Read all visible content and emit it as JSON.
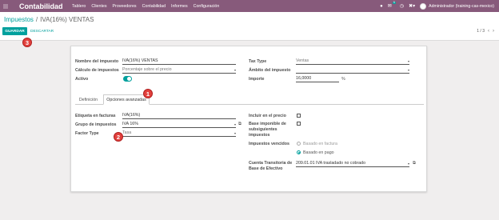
{
  "navbar": {
    "brand": "Contabilidad",
    "menu": [
      "Tablero",
      "Clientes",
      "Proveedores",
      "Contabilidad",
      "Informes",
      "Configuración"
    ],
    "chat_count": "5",
    "user": "Administrador (training-cas-mexico)"
  },
  "breadcrumb": {
    "parent": "Impuestos",
    "separator": "/",
    "current": "IVA(16%) VENTAS"
  },
  "actions": {
    "save": "GUARDAR",
    "discard": "DESCARTAR"
  },
  "pager": {
    "text": "1 / 3"
  },
  "markers": [
    "1",
    "2",
    "3"
  ],
  "form": {
    "name_label": "Nombre del impuesto",
    "name_value": "IVA(16%) VENTAS",
    "calc_label": "Cálculo de impuestos",
    "calc_value": "Porcentaje sobre el precio",
    "active_label": "Activo",
    "type_label": "Tax Type",
    "type_value": "Ventas",
    "scope_label": "Ámbito del impuesto",
    "scope_value": "",
    "amount_label": "Importe",
    "amount_value": "16,0000",
    "amount_unit": "%"
  },
  "tabs": {
    "definition": "Definición",
    "advanced": "Opciones avanzadas"
  },
  "advanced": {
    "invoice_label_label": "Etiqueta en facturas",
    "invoice_label_value": "IVA(16%)",
    "group_label": "Grupo de impuestos",
    "group_value": "IVA 16%",
    "factor_label": "Factor Type",
    "factor_value": "Tasa",
    "include_label": "Incluir en el precio",
    "base_label": "Base imponible de subsiguientes impuestos",
    "due_label": "Impuestos vencidos",
    "due_option_invoice": "Basado en factura",
    "due_option_payment": "Basado en pago",
    "transit_label": "Cuenta Transitoria de Base de Efectivo",
    "transit_value": "209.01.01 IVA trasladado no cobrado"
  },
  "colors": {
    "navbar": "#875a7b",
    "accent": "#00a09d",
    "marker": "#e2403c"
  }
}
